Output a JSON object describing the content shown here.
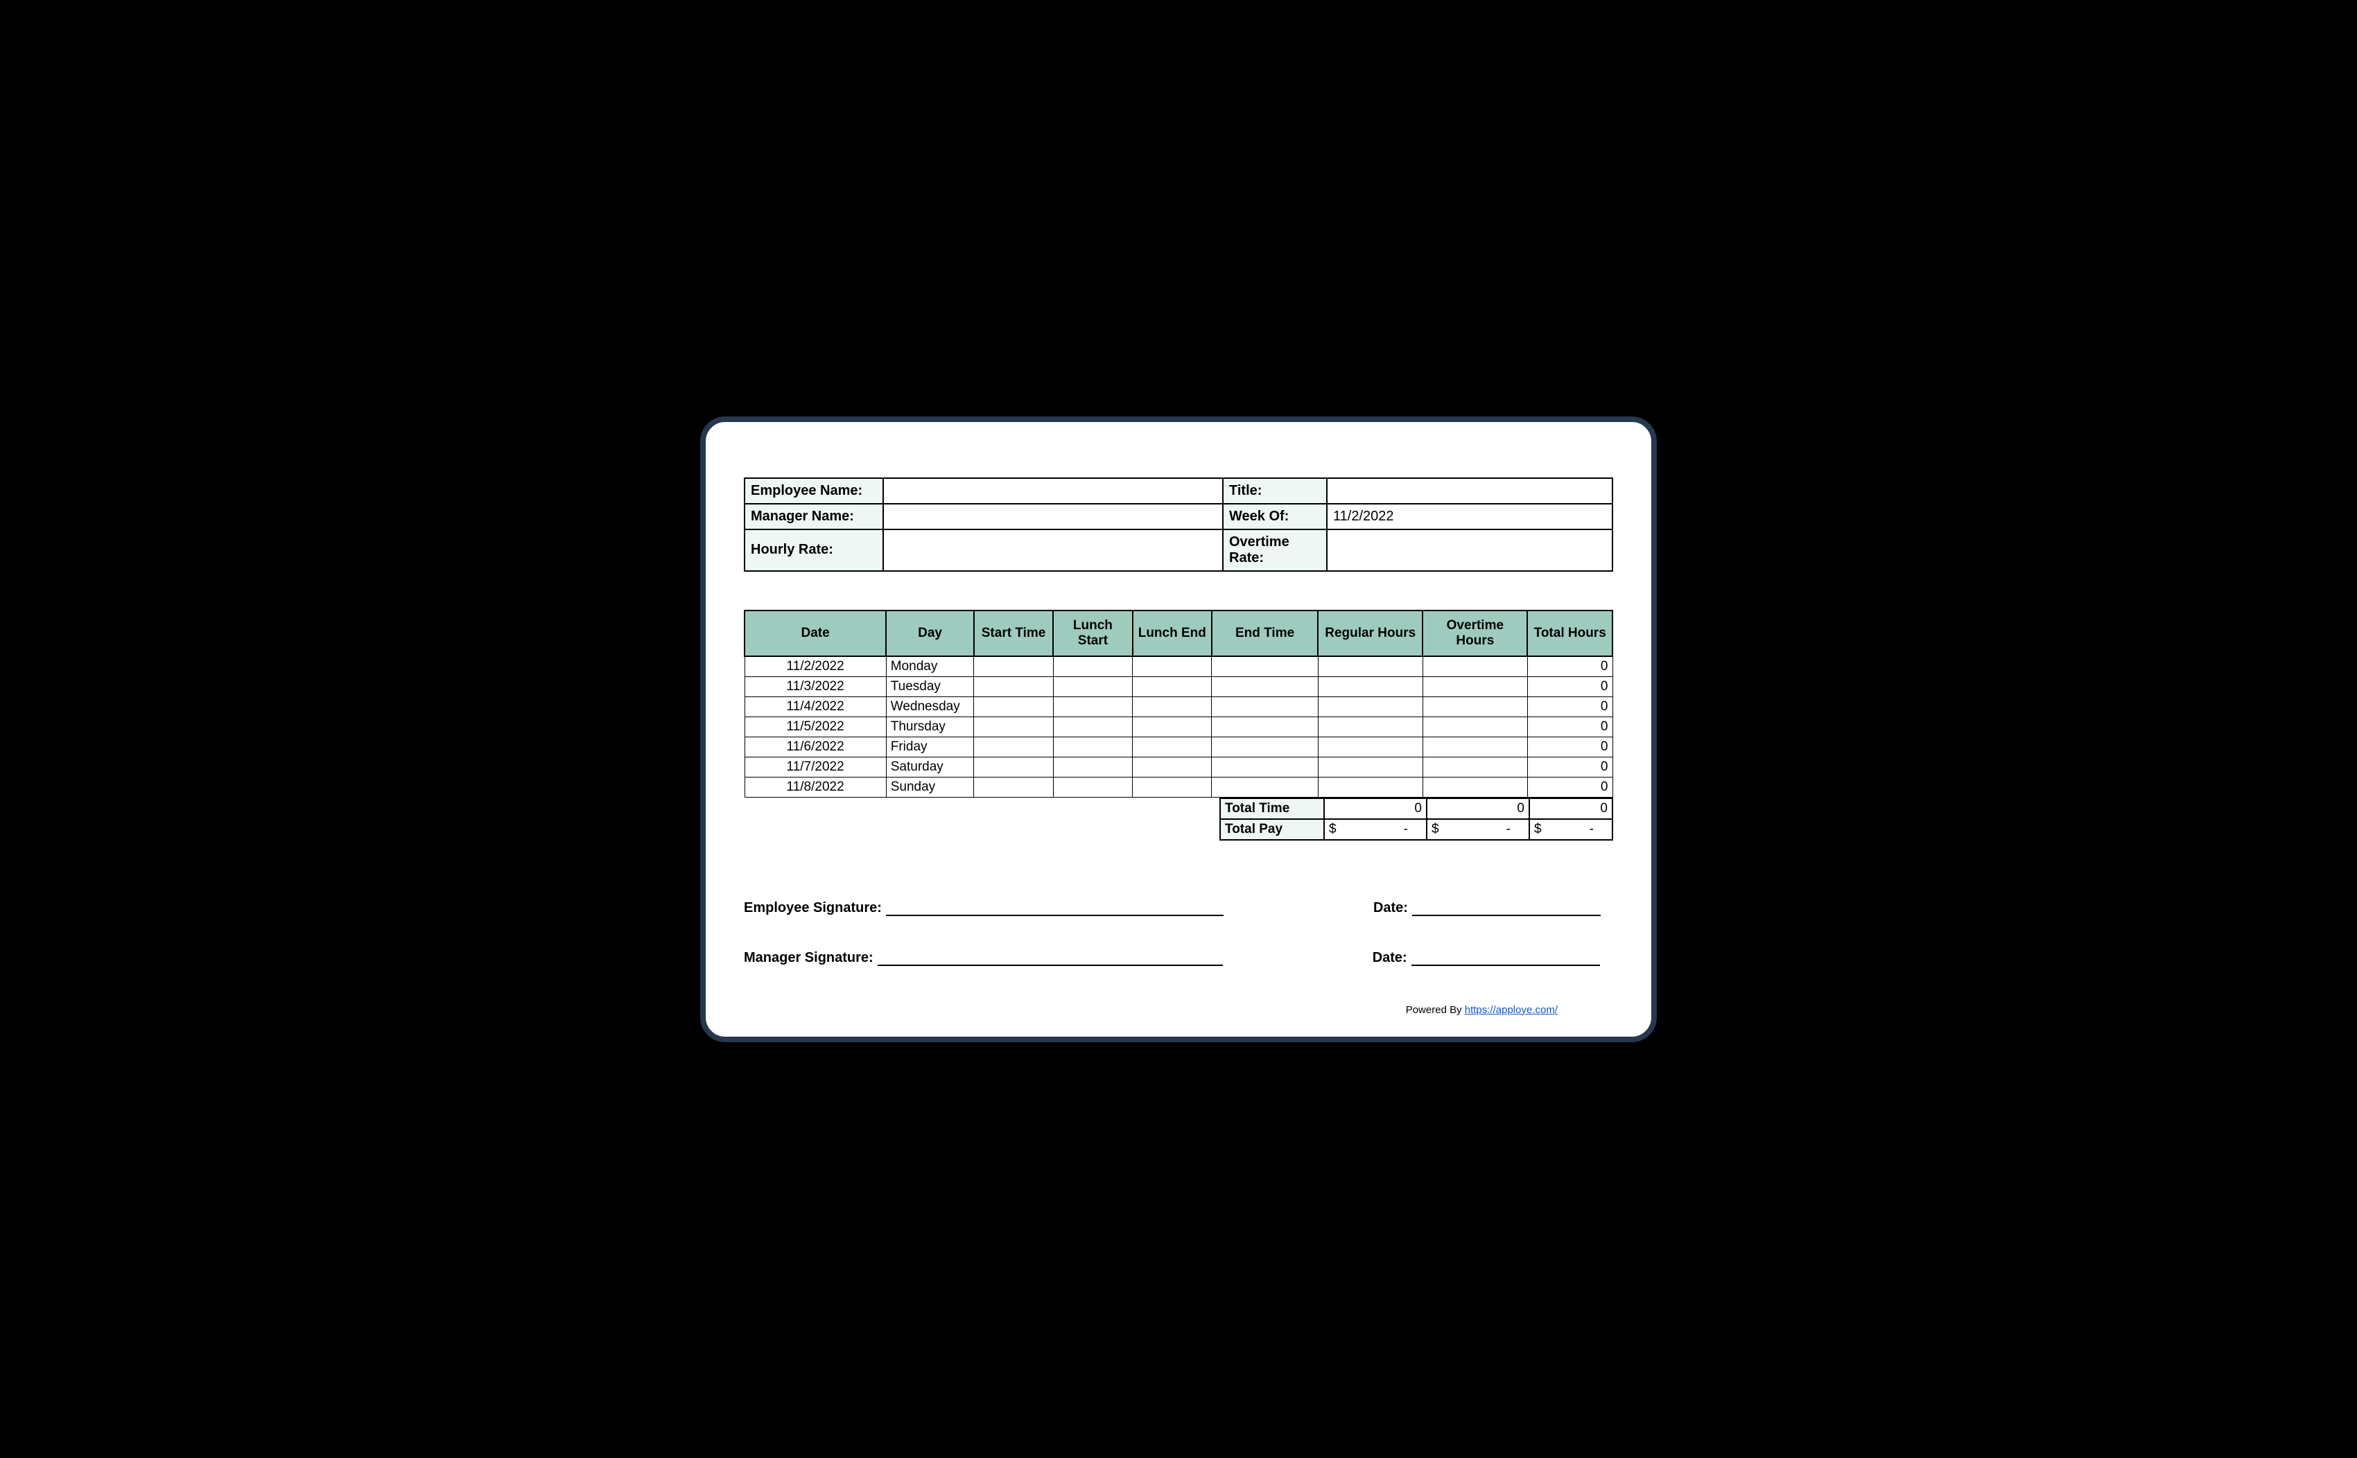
{
  "info": {
    "employee_name_label": "Employee Name:",
    "employee_name_value": "",
    "title_label": "Title:",
    "title_value": "",
    "manager_name_label": "Manager Name:",
    "manager_name_value": "",
    "week_of_label": "Week Of:",
    "week_of_value": "11/2/2022",
    "hourly_rate_label": "Hourly Rate:",
    "hourly_rate_value": "",
    "overtime_rate_label": "Overtime Rate:",
    "overtime_rate_value": ""
  },
  "headers": {
    "date": "Date",
    "day": "Day",
    "start": "Start Time",
    "lunch_start": "Lunch Start",
    "lunch_end": "Lunch End",
    "end": "End Time",
    "regular": "Regular Hours",
    "overtime": "Overtime Hours",
    "total": "Total Hours"
  },
  "rows": [
    {
      "date": "11/2/2022",
      "day": "Monday",
      "start": "",
      "lunch_start": "",
      "lunch_end": "",
      "end": "",
      "regular": "",
      "overtime": "",
      "total": "0"
    },
    {
      "date": "11/3/2022",
      "day": "Tuesday",
      "start": "",
      "lunch_start": "",
      "lunch_end": "",
      "end": "",
      "regular": "",
      "overtime": "",
      "total": "0"
    },
    {
      "date": "11/4/2022",
      "day": "Wednesday",
      "start": "",
      "lunch_start": "",
      "lunch_end": "",
      "end": "",
      "regular": "",
      "overtime": "",
      "total": "0"
    },
    {
      "date": "11/5/2022",
      "day": "Thursday",
      "start": "",
      "lunch_start": "",
      "lunch_end": "",
      "end": "",
      "regular": "",
      "overtime": "",
      "total": "0"
    },
    {
      "date": "11/6/2022",
      "day": "Friday",
      "start": "",
      "lunch_start": "",
      "lunch_end": "",
      "end": "",
      "regular": "",
      "overtime": "",
      "total": "0"
    },
    {
      "date": "11/7/2022",
      "day": "Saturday",
      "start": "",
      "lunch_start": "",
      "lunch_end": "",
      "end": "",
      "regular": "",
      "overtime": "",
      "total": "0"
    },
    {
      "date": "11/8/2022",
      "day": "Sunday",
      "start": "",
      "lunch_start": "",
      "lunch_end": "",
      "end": "",
      "regular": "",
      "overtime": "",
      "total": "0"
    }
  ],
  "totals": {
    "total_time_label": "Total Time",
    "total_time_regular": "0",
    "total_time_overtime": "0",
    "total_time_total": "0",
    "total_pay_label": "Total Pay",
    "dollar": "$",
    "dash": "-"
  },
  "signatures": {
    "employee_sig_label": "Employee Signature:",
    "manager_sig_label": "Manager Signature:",
    "date_label": "Date:"
  },
  "footer": {
    "powered_by": "Powered By ",
    "link_text": "https://apploye.com/"
  }
}
